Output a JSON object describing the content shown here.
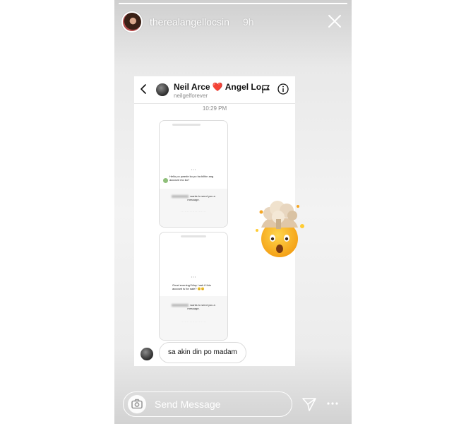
{
  "story": {
    "progress": 1.0,
    "username": "therealangellocsin",
    "time_ago": "9h",
    "close_icon": "close-icon"
  },
  "chat": {
    "name": "Neil Arce ❤️ Angel Lo...",
    "handle": "neilgelforever",
    "time": "10:29 PM",
    "reply": "sa akin din po madam"
  },
  "screenshot_1": {
    "message": "Hello po pwede ko po ba bilhin ang account mo ko?",
    "request": "wants to send you a message."
  },
  "screenshot_2": {
    "message": "Good evening! May I ask if this account is for sale? 😊😊",
    "request": "wants to send you a message."
  },
  "footer": {
    "placeholder": "Send Message"
  },
  "colors": {
    "accent_red": "#e0245e",
    "text_light": "#ffffff"
  }
}
